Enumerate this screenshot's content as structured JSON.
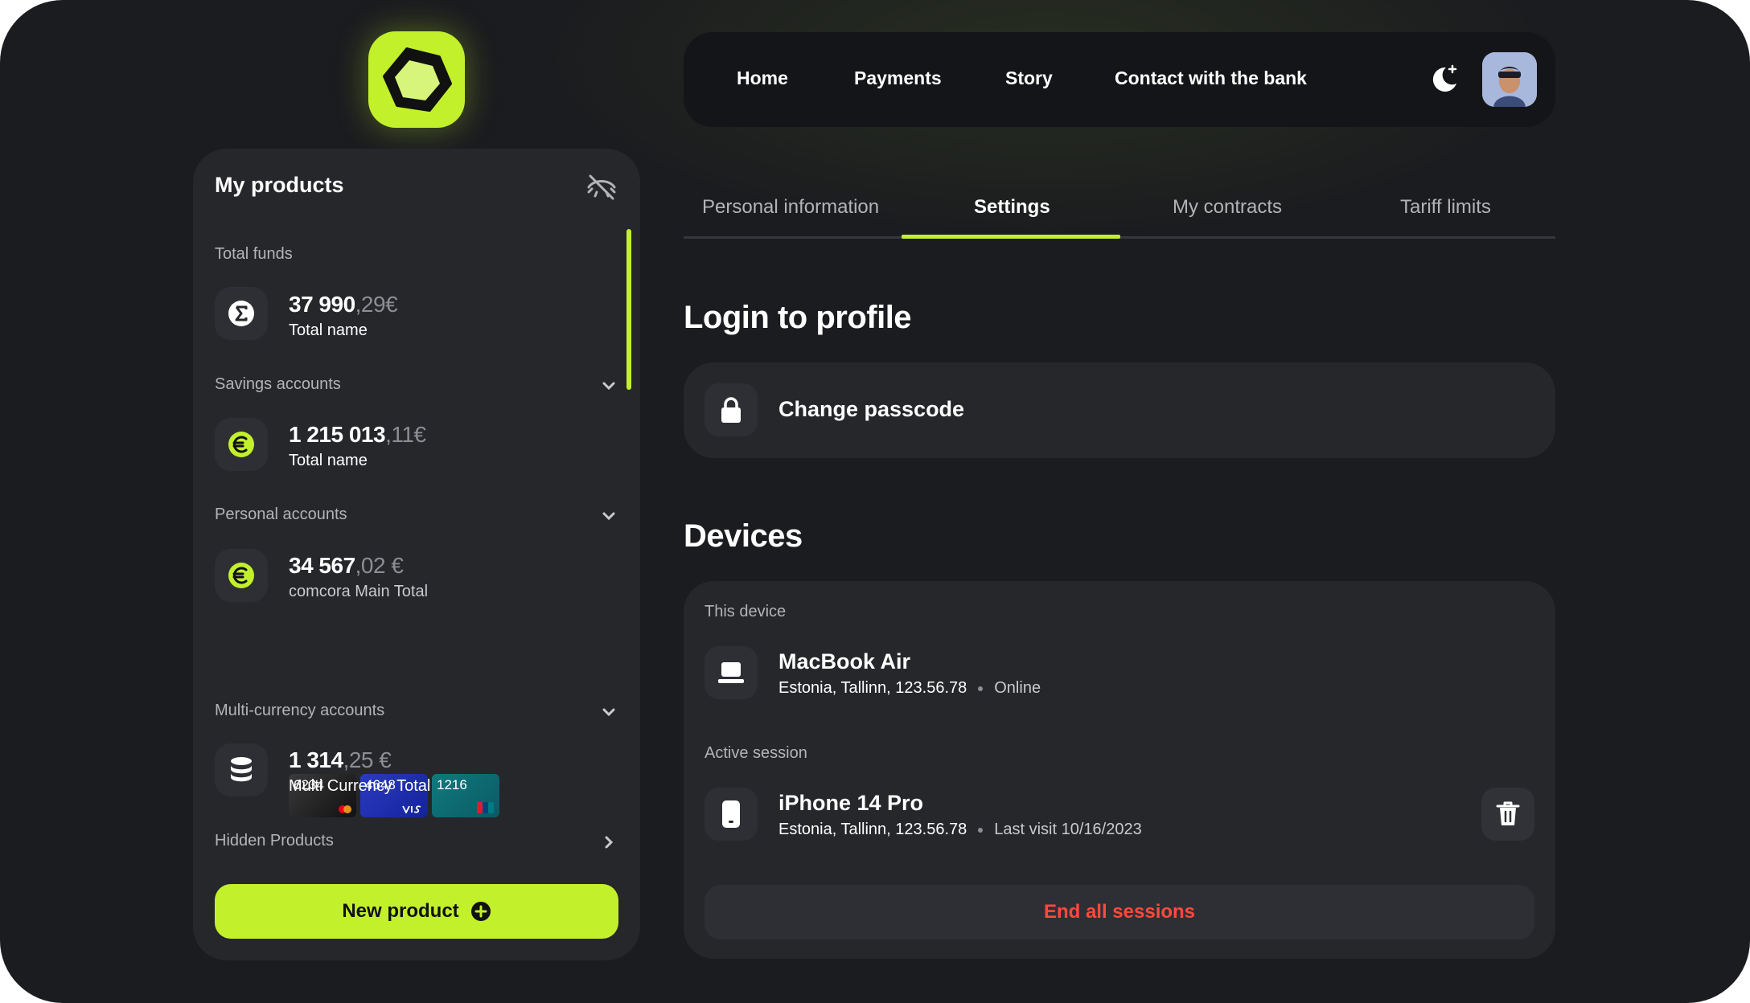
{
  "brand": {
    "accent": "#c2f12b",
    "danger": "#ff4a3d",
    "bg": "#1b1c1f",
    "panel": "#26272b"
  },
  "sidebar": {
    "title": "My products",
    "toggle_visibility_icon": "eye-off-icon",
    "sections": [
      {
        "label": "Total funds",
        "icon": "sigma-icon",
        "amount_main": "37 990",
        "amount_dec": ",29€",
        "name": "Total name"
      },
      {
        "label": "Savings accounts",
        "icon": "euro-icon",
        "amount_main": "1 215 013",
        "amount_dec": ",11€",
        "name": "Total name"
      },
      {
        "label": "Personal accounts",
        "icon": "euro-icon",
        "amount_main": "34 567",
        "amount_dec": ",02 €",
        "name": "comcora Main Total",
        "cards": [
          {
            "number": "6234"
          },
          {
            "number": "4648"
          },
          {
            "number": "1216"
          }
        ]
      },
      {
        "label": "Multi-currency accounts",
        "icon": "database-icon",
        "amount_main": "1 314",
        "amount_dec": ",25 €",
        "name": "Multi Currency Total"
      }
    ],
    "hidden_products": "Hidden Products",
    "new_product": "New product"
  },
  "nav": {
    "items": [
      "Home",
      "Payments",
      "Story",
      "Contact with the bank"
    ]
  },
  "tabs": [
    "Personal information",
    "Settings",
    "My contracts",
    "Tariff limits"
  ],
  "login": {
    "heading": "Login to profile",
    "change_passcode": "Change passcode"
  },
  "devices": {
    "heading": "Devices",
    "this_device_label": "This device",
    "this_device": {
      "name": "MacBook Air",
      "location": "Estonia, Tallinn, 123.56.78",
      "status": "Online"
    },
    "active_session_label": "Active session",
    "active_session": {
      "name": "iPhone 14 Pro",
      "location": "Estonia, Tallinn, 123.56.78",
      "status": "Last visit 10/16/2023"
    },
    "end_all": "End all sessions"
  }
}
